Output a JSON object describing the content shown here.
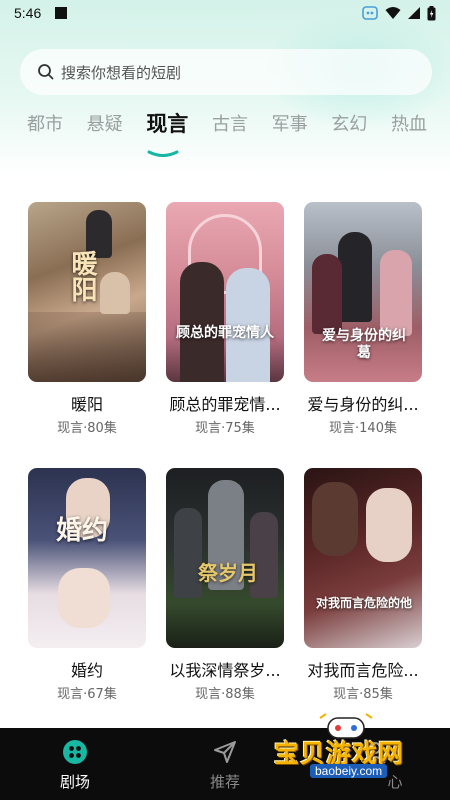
{
  "status_bar": {
    "time": "5:46"
  },
  "search": {
    "placeholder": "搜索你想看的短剧"
  },
  "tabs": [
    {
      "label": "都市",
      "active": false
    },
    {
      "label": "悬疑",
      "active": false
    },
    {
      "label": "现言",
      "active": true
    },
    {
      "label": "古言",
      "active": false
    },
    {
      "label": "军事",
      "active": false
    },
    {
      "label": "玄幻",
      "active": false
    },
    {
      "label": "热血",
      "active": false
    }
  ],
  "dramas": [
    {
      "title": "暖阳",
      "meta": "现言·80集",
      "poster_text": "暖阳"
    },
    {
      "title": "顾总的罪宠情...",
      "meta": "现言·75集",
      "poster_text": "顾总的罪宠情人"
    },
    {
      "title": "爱与身份的纠...",
      "meta": "现言·140集",
      "poster_text": "爱与身份的纠葛"
    },
    {
      "title": "婚约",
      "meta": "现言·67集",
      "poster_text": "婚约"
    },
    {
      "title": "以我深情祭岁...",
      "meta": "现言·88集",
      "poster_text": "祭岁月"
    },
    {
      "title": "对我而言危险...",
      "meta": "现言·85集",
      "poster_text": "对我而言危险的他"
    }
  ],
  "bottom_nav": [
    {
      "label": "剧场",
      "icon": "theater-icon",
      "active": true
    },
    {
      "label": "推荐",
      "icon": "send-arrow-icon",
      "active": false
    },
    {
      "label": "心",
      "icon": "profile-icon",
      "active": false
    }
  ],
  "watermark": {
    "title": "宝贝游戏网",
    "url": "baobeiy.com"
  },
  "colors": {
    "accent": "#17b7a3",
    "nav_bg": "#0c0c0c",
    "header_bg": "#d4f2e9"
  }
}
